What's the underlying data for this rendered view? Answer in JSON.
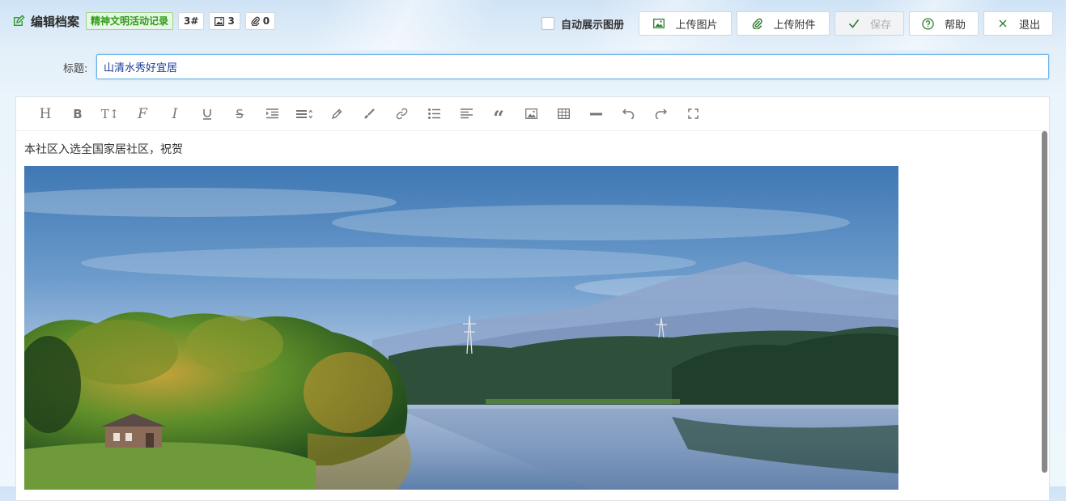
{
  "header": {
    "title": "编辑档案",
    "category_tag": "精神文明活动记录",
    "number_chip": "3#",
    "image_count": "3",
    "attachment_count": "0"
  },
  "actions": {
    "auto_show_album": "自动展示图册",
    "upload_image": "上传图片",
    "upload_attachment": "上传附件",
    "save": "保存",
    "help": "帮助",
    "exit": "退出"
  },
  "form": {
    "title_label": "标题:",
    "title_value": "山清水秀好宜居"
  },
  "editor": {
    "toolbar": [
      {
        "name": "heading",
        "icon": "heading-icon"
      },
      {
        "name": "bold",
        "icon": "bold-icon"
      },
      {
        "name": "font-size",
        "icon": "text-size-icon"
      },
      {
        "name": "font-family",
        "icon": "font-family-icon"
      },
      {
        "name": "italic",
        "icon": "italic-icon"
      },
      {
        "name": "underline",
        "icon": "underline-icon"
      },
      {
        "name": "strikethrough",
        "icon": "strikethrough-icon"
      },
      {
        "name": "indent",
        "icon": "indent-icon"
      },
      {
        "name": "line-height",
        "icon": "line-height-icon"
      },
      {
        "name": "text-color",
        "icon": "pencil-icon"
      },
      {
        "name": "background-color",
        "icon": "brush-icon"
      },
      {
        "name": "link",
        "icon": "link-icon"
      },
      {
        "name": "list",
        "icon": "list-icon"
      },
      {
        "name": "justify",
        "icon": "align-left-icon"
      },
      {
        "name": "quote",
        "icon": "quote-icon"
      },
      {
        "name": "image",
        "icon": "image-icon"
      },
      {
        "name": "table",
        "icon": "table-icon"
      },
      {
        "name": "divider",
        "icon": "horizontal-rule-icon"
      },
      {
        "name": "undo",
        "icon": "undo-icon"
      },
      {
        "name": "redo",
        "icon": "redo-icon"
      },
      {
        "name": "fullscreen",
        "icon": "fullscreen-icon"
      }
    ],
    "body_text": "本社区入选全国家居社区，祝贺"
  },
  "colors": {
    "accent_green": "#2f9a1a",
    "input_border": "#66b1e8",
    "input_text": "#1a3a9b"
  }
}
